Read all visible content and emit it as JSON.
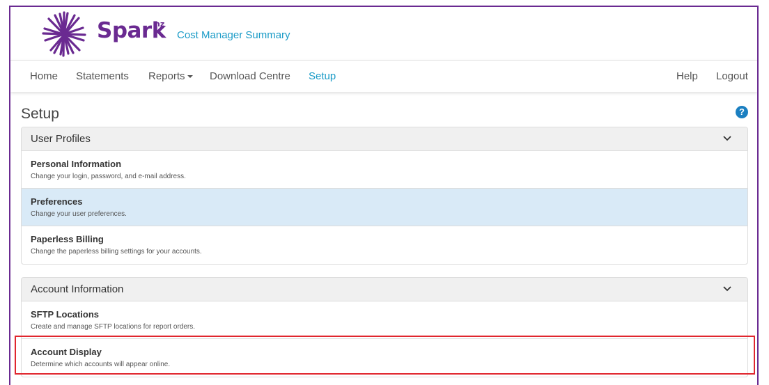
{
  "header": {
    "brand_name": "Spark",
    "brand_suffix": "nz",
    "app_title": "Cost Manager Summary",
    "brand_color": "#6a2a91",
    "accent_color": "#1a9bc7"
  },
  "nav": {
    "home": "Home",
    "statements": "Statements",
    "reports": "Reports",
    "download_centre": "Download Centre",
    "setup": "Setup",
    "help": "Help",
    "logout": "Logout",
    "active": "Setup"
  },
  "page": {
    "title": "Setup",
    "help_icon": "question-circle-icon",
    "help_symbol": "?"
  },
  "panels": [
    {
      "heading": "User Profiles",
      "items": [
        {
          "title": "Personal Information",
          "desc": "Change your login, password, and e-mail address."
        },
        {
          "title": "Preferences",
          "desc": "Change your user preferences."
        },
        {
          "title": "Paperless Billing",
          "desc": "Change the paperless billing settings for your accounts."
        }
      ]
    },
    {
      "heading": "Account Information",
      "items": [
        {
          "title": "SFTP Locations",
          "desc": "Create and manage SFTP locations for report orders."
        },
        {
          "title": "Account Display",
          "desc": "Determine which accounts will appear online."
        }
      ]
    }
  ],
  "highlight_color": "#e0262e"
}
